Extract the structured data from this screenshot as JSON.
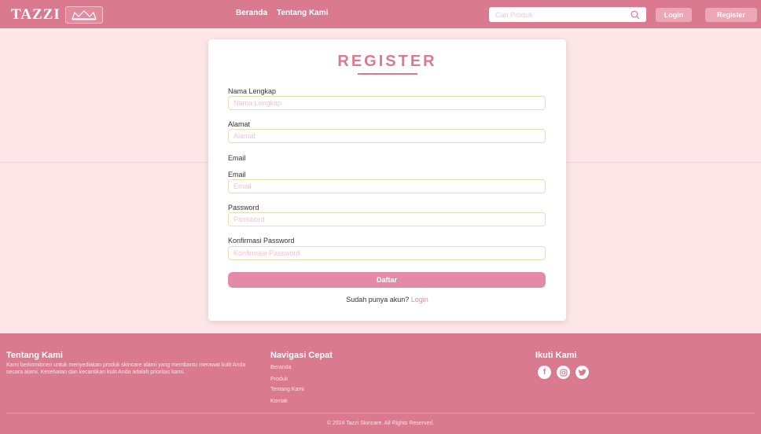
{
  "header": {
    "brand": "TAZZI",
    "nav": [
      "Beranda",
      "Tentang Kami"
    ],
    "search_placeholder": "Cari Produk",
    "login_label": "Login",
    "register_label": "Register"
  },
  "form": {
    "title": "REGISTER",
    "fields": [
      {
        "label": "Nama Lengkap",
        "placeholder": "Nama Lengkap"
      },
      {
        "label": "Alamat",
        "placeholder": "Alamat"
      },
      {
        "label": "Email",
        "placeholder": ""
      },
      {
        "label": "Email",
        "placeholder": "Email"
      },
      {
        "label": "Password",
        "placeholder": "Password"
      },
      {
        "label": "Konfirmasi Password",
        "placeholder": "Konfirmasi Password"
      }
    ],
    "submit_label": "Daftar",
    "login_prompt": "Sudah punya akun?",
    "login_link": "Login"
  },
  "footer": {
    "about_title": "Tentang Kami",
    "about_text": "Kami berkomitmen untuk menyediakan produk skincare alami yang membantu merawat kulit Anda secara alami. Kesehatan dan kecantikan kulit Anda adalah prioritas kami.",
    "nav_title": "Navigasi Cepat",
    "nav_links": [
      "Beranda",
      "Produk",
      "Tentang Kami",
      "Kontak"
    ],
    "social_title": "Ikuti Kami",
    "social_icons": [
      "facebook-icon",
      "instagram-icon",
      "twitter-icon"
    ],
    "copyright": "© 2024 Tazzi Skincare. All Rights Reserved."
  },
  "colors": {
    "primary": "#d97a8e",
    "background": "#fde6e8",
    "button": "#e48aa6"
  }
}
